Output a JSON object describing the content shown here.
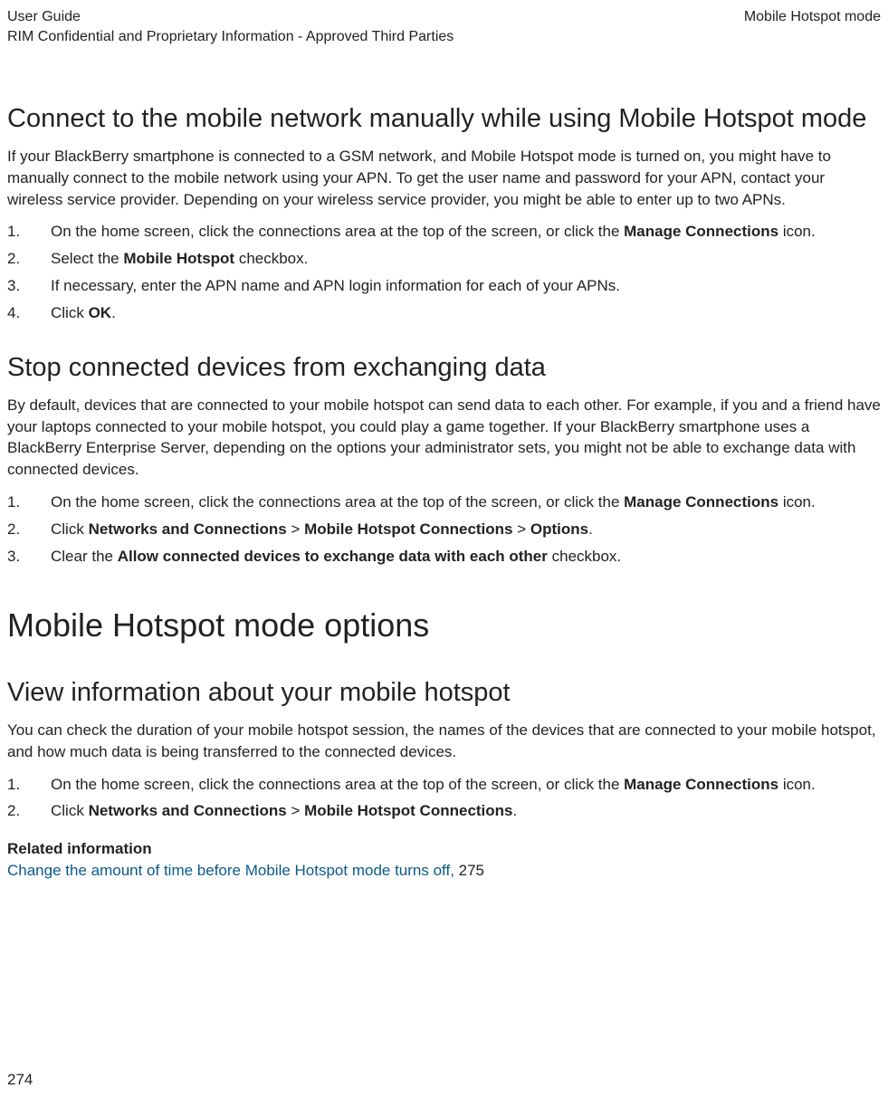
{
  "header": {
    "left_line1": "User Guide",
    "left_line2": "RIM Confidential and Proprietary Information - Approved Third Parties",
    "right": "Mobile Hotspot mode"
  },
  "section1": {
    "heading": "Connect to the mobile network manually while using Mobile Hotspot mode",
    "para": "If your BlackBerry smartphone is connected to a GSM network, and Mobile Hotspot mode is turned on, you might have to manually connect to the mobile network using your APN. To get the user name and password for your APN, contact your wireless service provider. Depending on your wireless service provider, you might be able to enter up to two APNs.",
    "step1_pre": "On the home screen, click the connections area at the top of the screen, or click the ",
    "step1_bold": "Manage Connections",
    "step1_post": " icon.",
    "step2_pre": "Select the ",
    "step2_bold": "Mobile Hotspot",
    "step2_post": " checkbox.",
    "step3": "If necessary, enter the APN name and APN login information for each of your APNs.",
    "step4_pre": "Click ",
    "step4_bold": "OK",
    "step4_post": "."
  },
  "section2": {
    "heading": "Stop connected devices from exchanging data",
    "para": "By default, devices that are connected to your mobile hotspot can send data to each other. For example, if you and a friend have your laptops connected to your mobile hotspot, you could play a game together. If your BlackBerry smartphone uses a BlackBerry Enterprise Server, depending on the options your administrator sets, you might not be able to exchange data with connected devices.",
    "step1_pre": "On the home screen, click the connections area at the top of the screen, or click the ",
    "step1_bold": "Manage Connections",
    "step1_post": " icon.",
    "step2_pre": "Click ",
    "step2_b1": "Networks and Connections",
    "step2_sep1": " > ",
    "step2_b2": "Mobile Hotspot Connections",
    "step2_sep2": " > ",
    "step2_b3": "Options",
    "step2_post": ".",
    "step3_pre": "Clear the ",
    "step3_bold": "Allow connected devices to exchange data with each other",
    "step3_post": " checkbox."
  },
  "mainhead": "Mobile Hotspot mode options",
  "section3": {
    "heading": "View information about your mobile hotspot",
    "para": "You can check the duration of your mobile hotspot session, the names of the devices that are connected to your mobile hotspot, and how much data is being transferred to the connected devices.",
    "step1_pre": "On the home screen, click the connections area at the top of the screen, or click the ",
    "step1_bold": "Manage Connections",
    "step1_post": " icon.",
    "step2_pre": "Click ",
    "step2_b1": "Networks and Connections",
    "step2_sep1": " > ",
    "step2_b2": "Mobile Hotspot Connections",
    "step2_post": "."
  },
  "related": {
    "heading": "Related information",
    "link_text": "Change the amount of time before Mobile Hotspot mode turns off, ",
    "page_ref": "275"
  },
  "footer": {
    "page_num": "274"
  }
}
